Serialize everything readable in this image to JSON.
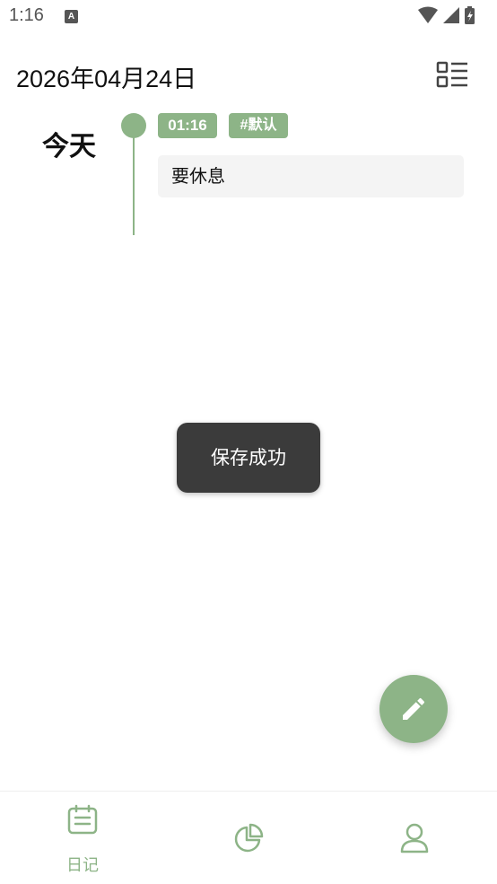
{
  "status_bar": {
    "time": "1:16",
    "notification_icon_letter": "A"
  },
  "header": {
    "date": "2026年04月24日"
  },
  "timeline": {
    "day_label": "今天",
    "entries": [
      {
        "time": "01:16",
        "category": "#默认",
        "content": "要休息"
      }
    ]
  },
  "toast": {
    "message": "保存成功"
  },
  "bottom_nav": {
    "items": [
      {
        "label": "日记",
        "icon": "diary-icon",
        "active": true
      },
      {
        "label": "",
        "icon": "pie-chart-icon",
        "active": false
      },
      {
        "label": "",
        "icon": "profile-icon",
        "active": false
      }
    ]
  },
  "colors": {
    "accent": "#8db487",
    "toast_bg": "#3b3b3b",
    "card_bg": "#f4f4f4"
  }
}
